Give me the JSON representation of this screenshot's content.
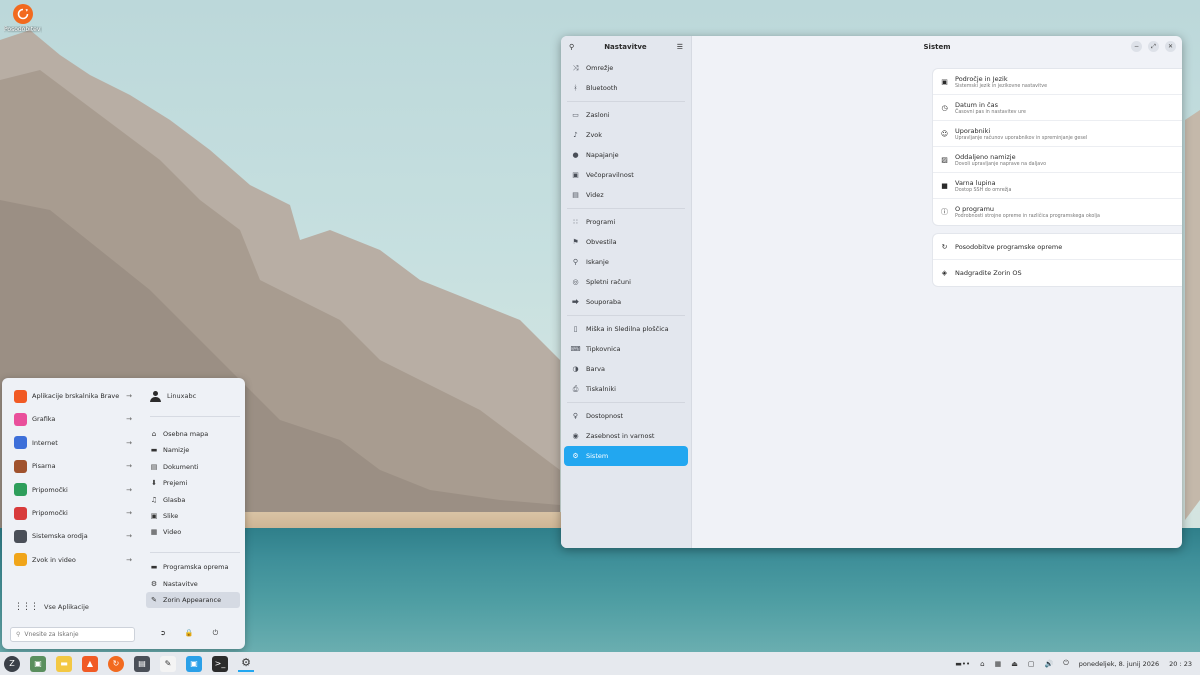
{
  "desktop": {
    "icon_label": "Posodobitev programov"
  },
  "settings": {
    "sidebar_title": "Nastavitve",
    "main_title": "Sistem",
    "sidebar_items": [
      {
        "label": "Omrežje",
        "icon": "network-icon"
      },
      {
        "label": "Bluetooth",
        "icon": "bluetooth-icon"
      },
      {
        "label": "Zasloni",
        "icon": "display-icon"
      },
      {
        "label": "Zvok",
        "icon": "speaker-icon"
      },
      {
        "label": "Napajanje",
        "icon": "power-icon"
      },
      {
        "label": "Večopravilnost",
        "icon": "multitask-icon"
      },
      {
        "label": "Videz",
        "icon": "appearance-icon"
      },
      {
        "label": "Programi",
        "icon": "apps-icon"
      },
      {
        "label": "Obvestila",
        "icon": "bell-icon"
      },
      {
        "label": "Iskanje",
        "icon": "search-icon"
      },
      {
        "label": "Spletni računi",
        "icon": "accounts-icon"
      },
      {
        "label": "Souporaba",
        "icon": "share-icon"
      },
      {
        "label": "Miška in Sledilna ploščica",
        "icon": "mouse-icon"
      },
      {
        "label": "Tipkovnica",
        "icon": "keyboard-icon"
      },
      {
        "label": "Barva",
        "icon": "color-icon"
      },
      {
        "label": "Tiskalniki",
        "icon": "printer-icon"
      },
      {
        "label": "Dostopnost",
        "icon": "accessibility-icon"
      },
      {
        "label": "Zasebnost in varnost",
        "icon": "privacy-icon"
      },
      {
        "label": "Sistem",
        "icon": "gear-icon"
      }
    ],
    "system_rows": [
      {
        "title": "Področje in Jezik",
        "subtitle": "Sistemski jezik in jezikovne nastavitve"
      },
      {
        "title": "Datum in čas",
        "subtitle": "Časovni pas in nastavitev ure"
      },
      {
        "title": "Uporabniki",
        "subtitle": "Upravljanje računov uporabnikov in spreminjanje gesel"
      },
      {
        "title": "Oddaljeno namizje",
        "subtitle": "Dovoli upravljanje naprave na daljavo"
      },
      {
        "title": "Varna lupina",
        "subtitle": "Dostop SSH do omrežja"
      },
      {
        "title": "O programu",
        "subtitle": "Podrobnosti strojne opreme in različica programskega okolja"
      }
    ],
    "link_rows": [
      {
        "title": "Posodobitve programske opreme"
      },
      {
        "title": "Nadgradite Zorin OS"
      }
    ]
  },
  "menu": {
    "categories": [
      {
        "label": "Aplikacije brskalnika Brave",
        "color": "#f15a24"
      },
      {
        "label": "Grafika",
        "color": "#e94f9b"
      },
      {
        "label": "Internet",
        "color": "#3d6fd9"
      },
      {
        "label": "Pisarna",
        "color": "#a0522d"
      },
      {
        "label": "Pripomočki",
        "color": "#2e9e5b"
      },
      {
        "label": "Pripomočki",
        "color": "#d83b3b"
      },
      {
        "label": "Sistemska orodja",
        "color": "#4a4f58"
      },
      {
        "label": "Zvok in video",
        "color": "#f0a51a"
      }
    ],
    "user": "Linuxabc",
    "places": [
      "Osebna mapa",
      "Namizje",
      "Dokumenti",
      "Prejemi",
      "Glasba",
      "Slike",
      "Video"
    ],
    "system": [
      "Programska oprema",
      "Nastavitve",
      "Zorin Appearance"
    ],
    "all_apps": "Vse Aplikacije",
    "search_placeholder": "Vnesite za Iskanje"
  },
  "tray": {
    "date": "ponedeljek, 8. junij 2026",
    "time": "20 : 23"
  }
}
